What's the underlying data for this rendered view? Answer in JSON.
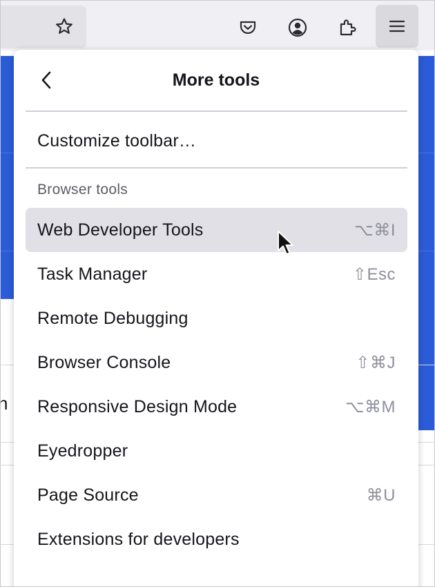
{
  "toolbar": {
    "bookmark_icon": "star-icon",
    "pocket_icon": "pocket-icon",
    "account_icon": "account-icon",
    "extensions_icon": "puzzle-icon",
    "menu_icon": "hamburger-icon"
  },
  "panel": {
    "title": "More tools",
    "back_icon": "chevron-left-icon",
    "customize_label": "Customize toolbar…",
    "section_label": "Browser tools",
    "items": [
      {
        "label": "Web Developer Tools",
        "shortcut": "⌥⌘I"
      },
      {
        "label": "Task Manager",
        "shortcut": "⇧Esc"
      },
      {
        "label": "Remote Debugging",
        "shortcut": ""
      },
      {
        "label": "Browser Console",
        "shortcut": "⇧⌘J"
      },
      {
        "label": "Responsive Design Mode",
        "shortcut": "⌥⌘M"
      },
      {
        "label": "Eyedropper",
        "shortcut": ""
      },
      {
        "label": "Page Source",
        "shortcut": "⌘U"
      },
      {
        "label": "Extensions for developers",
        "shortcut": ""
      }
    ]
  },
  "background": {
    "partial_letter": "n"
  },
  "colors": {
    "accent_blue": "#2b5bd7",
    "hover_bg": "#e0e0e6",
    "text": "#15141a",
    "shortcut_text": "#8f8f9d"
  }
}
